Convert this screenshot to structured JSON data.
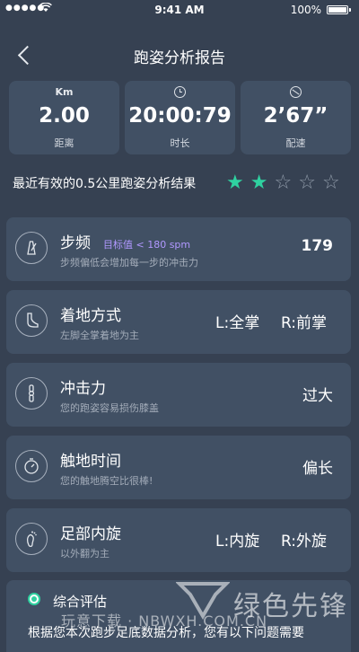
{
  "status_bar": {
    "signal": "●●●●●",
    "time": "9:41 AM",
    "battery": "100%"
  },
  "nav": {
    "title": "跑姿分析报告"
  },
  "stats": [
    {
      "top": "Km",
      "value": "2.00",
      "label": "距离"
    },
    {
      "icon": "clock-icon",
      "value": "20:00:79",
      "label": "时长"
    },
    {
      "icon": "speedometer-icon",
      "value": "2’67”",
      "label": "配速"
    }
  ],
  "summary": {
    "text": "最近有效的0.5公里跑姿分析结果",
    "rating": 2,
    "max_rating": 5,
    "star_color": "#2fd1a0"
  },
  "metrics": [
    {
      "icon": "metronome-icon",
      "title": "步频",
      "target": "目标值 < 180 spm",
      "subtitle": "步频偏低会增加每一步的冲击力",
      "value": "179"
    },
    {
      "icon": "foot-icon",
      "title": "着地方式",
      "subtitle": "左脚全掌着地为主",
      "left_value": "L:全掌",
      "right_value": "R:前掌"
    },
    {
      "icon": "knee-icon",
      "title": "冲击力",
      "subtitle": "您的跑姿容易损伤膝盖",
      "value": "过大"
    },
    {
      "icon": "stopwatch-icon",
      "title": "触地时间",
      "subtitle": "您的触地腾空比很棒!",
      "value": "偏长"
    },
    {
      "icon": "footprint-icon",
      "title": "足部内旋",
      "subtitle": "以外翻为主",
      "left_value": "L:内旋",
      "right_value": "R:外旋"
    }
  ],
  "overall": {
    "title": "综合评估",
    "text": "根据您本次跑步足底数据分析，您有以下问题需要"
  },
  "watermark": {
    "left_text": "玩意下载 · NBWXH.COM.CN",
    "brand": "绿色先锋"
  },
  "colors": {
    "background": "#364152",
    "card": "#415064",
    "accent": "#2fd1a0",
    "target": "#b198ff"
  }
}
